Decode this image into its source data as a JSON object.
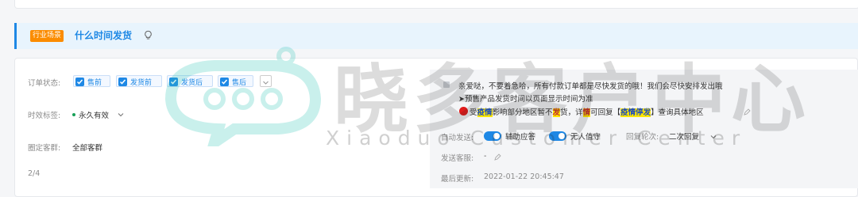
{
  "scene": {
    "tag": "行业场景",
    "title": "什么时间发货"
  },
  "fields": {
    "order_status_label": "订单状态:",
    "order_status_options": [
      "售前",
      "发货前",
      "发货后",
      "售后"
    ],
    "validity_label": "时效标签:",
    "validity_value": "永久有效",
    "customer_group_label": "圈定客群:",
    "customer_group_value": "全部客群",
    "pagination": "2/4"
  },
  "reply": {
    "line1": "亲爱哒，不要着急哈，所有付款订单都是尽快发货的哦！我们会尽快安排发出哦",
    "line2": "➤预售产品发货时间以页面显示时间为准",
    "line3_prefix": "受",
    "line3_hl1": "疫情",
    "line3_mid": "影响部分地区暂不",
    "line3_hl2": "发",
    "line3_mid2": "货，详",
    "line3_hl3": "情",
    "line3_mid3": "可回复【",
    "line3_hl4": "疫情停发",
    "line3_suffix": "】查询具体地区",
    "auto_send_label": "自动发送:",
    "toggle1_label": "辅助应答",
    "toggle2_label": "无人值守",
    "round_label": "回复轮次:",
    "round_value": "二次回复",
    "sender_label": "发送客服:",
    "sender_value": "-",
    "last_update_label": "最后更新:",
    "last_update_value": "2022-01-22 20:45:47"
  },
  "watermark": {
    "cn": "晓多客户中心",
    "en": "Xiaoduo Customer Center"
  },
  "colors": {
    "accent": "#1e88e5",
    "tag": "#fb8c00",
    "highlight": "#ffe600",
    "watermark": "#2ec4b6"
  }
}
